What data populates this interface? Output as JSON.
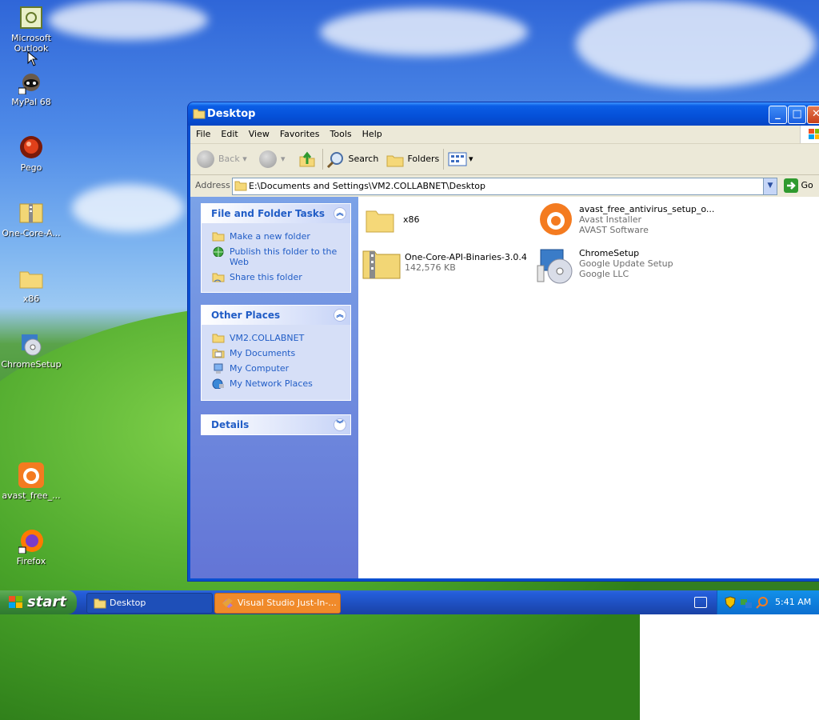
{
  "desktop": {
    "icons": [
      {
        "label": "Microsoft Outlook",
        "icon": "outlook-icon"
      },
      {
        "label": "MyPal 68",
        "icon": "mypal-icon"
      },
      {
        "label": "Pego",
        "icon": "pego-icon"
      },
      {
        "label": "One-Core-A...",
        "icon": "zip-folder-icon"
      },
      {
        "label": "x86",
        "icon": "folder-icon"
      },
      {
        "label": "ChromeSetup",
        "icon": "setup-icon"
      },
      {
        "label": "avast_free_...",
        "icon": "avast-icon"
      },
      {
        "label": "Firefox",
        "icon": "firefox-icon"
      }
    ]
  },
  "window": {
    "title": "Desktop",
    "menu": [
      "File",
      "Edit",
      "View",
      "Favorites",
      "Tools",
      "Help"
    ],
    "toolbar": {
      "back": "Back",
      "search": "Search",
      "folders": "Folders"
    },
    "address": {
      "label": "Address",
      "value": "E:\\Documents and Settings\\VM2.COLLABNET\\Desktop",
      "go": "Go"
    },
    "task_panels": {
      "file_tasks": {
        "title": "File and Folder Tasks",
        "links": [
          "Make a new folder",
          "Publish this folder to the Web",
          "Share this folder"
        ]
      },
      "other_places": {
        "title": "Other Places",
        "links": [
          "VM2.COLLABNET",
          "My Documents",
          "My Computer",
          "My Network Places"
        ]
      },
      "details": {
        "title": "Details"
      }
    },
    "files": [
      {
        "name": "x86",
        "line2": "",
        "line3": ""
      },
      {
        "name": "avast_free_antivirus_setup_o...",
        "line2": "Avast Installer",
        "line3": "AVAST Software"
      },
      {
        "name": "One-Core-API-Binaries-3.0.4",
        "line2": "142,576 KB",
        "line3": ""
      },
      {
        "name": "ChromeSetup",
        "line2": "Google Update Setup",
        "line3": "Google LLC"
      }
    ]
  },
  "taskbar": {
    "start": "start",
    "items": [
      "Desktop",
      "Visual Studio Just-In-..."
    ],
    "clock": "5:41 AM"
  }
}
